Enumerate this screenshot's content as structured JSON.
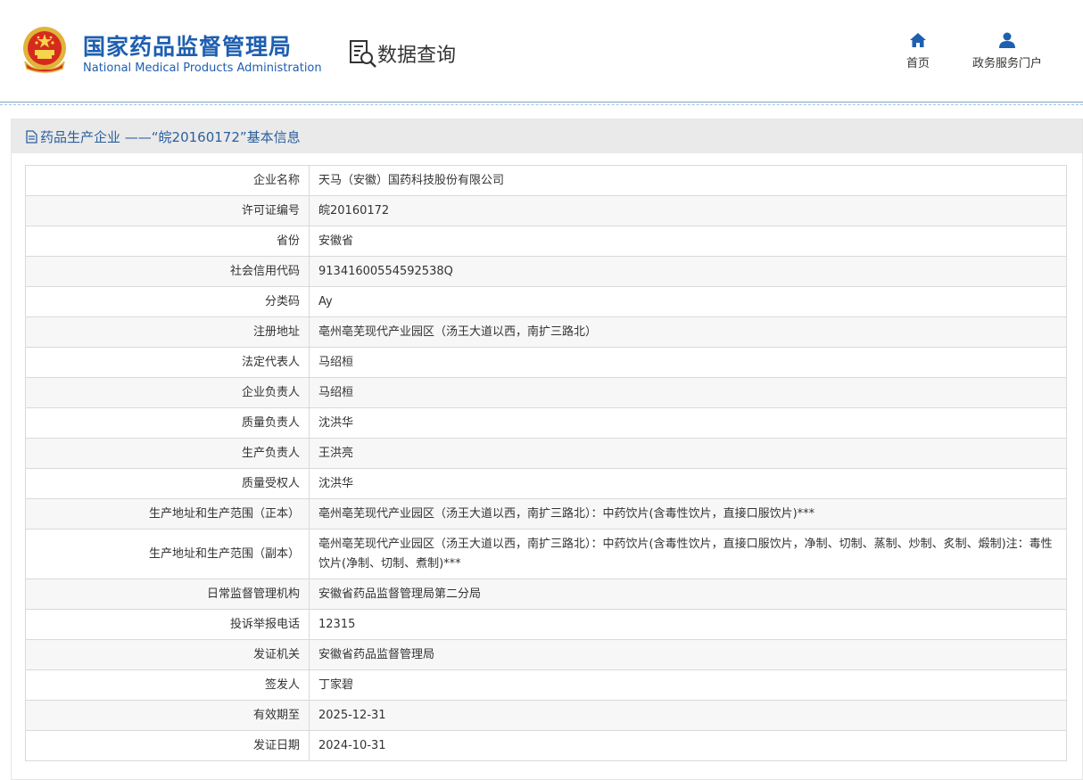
{
  "header": {
    "brand_cn": "国家药品监督管理局",
    "brand_en": "National Medical Products Administration",
    "query_title": "数据查询",
    "nav_home": "首页",
    "nav_portal": "政务服务门户",
    "icons": [
      "national-emblem-icon",
      "data-query-icon",
      "home-icon",
      "user-icon"
    ],
    "accent_color": "#1e5fb0"
  },
  "panel": {
    "title": "药品生产企业 ——“皖20160172”基本信息",
    "icon": "document-icon"
  },
  "rows": [
    {
      "label": "企业名称",
      "value": "天马（安徽）国药科技股份有限公司"
    },
    {
      "label": "许可证编号",
      "value": "皖20160172"
    },
    {
      "label": "省份",
      "value": "安徽省"
    },
    {
      "label": "社会信用代码",
      "value": "91341600554592538Q"
    },
    {
      "label": "分类码",
      "value": "Ay"
    },
    {
      "label": "注册地址",
      "value": "亳州亳芜现代产业园区（汤王大道以西，南扩三路北）"
    },
    {
      "label": "法定代表人",
      "value": "马绍桓"
    },
    {
      "label": "企业负责人",
      "value": "马绍桓"
    },
    {
      "label": "质量负责人",
      "value": "沈洪华"
    },
    {
      "label": "生产负责人",
      "value": "王洪亮"
    },
    {
      "label": "质量受权人",
      "value": "沈洪华"
    },
    {
      "label": "生产地址和生产范围（正本）",
      "value": "亳州亳芜现代产业园区（汤王大道以西，南扩三路北）：中药饮片(含毒性饮片，直接口服饮片)***"
    },
    {
      "label": "生产地址和生产范围（副本）",
      "value": "亳州亳芜现代产业园区（汤王大道以西，南扩三路北）：中药饮片(含毒性饮片，直接口服饮片，净制、切制、蒸制、炒制、炙制、煅制)注：毒性饮片(净制、切制、煮制)***"
    },
    {
      "label": "日常监督管理机构",
      "value": "安徽省药品监督管理局第二分局"
    },
    {
      "label": "投诉举报电话",
      "value": "12315"
    },
    {
      "label": "发证机关",
      "value": "安徽省药品监督管理局"
    },
    {
      "label": "签发人",
      "value": "丁家碧"
    },
    {
      "label": "有效期至",
      "value": "2025-12-31"
    },
    {
      "label": "发证日期",
      "value": "2024-10-31"
    }
  ]
}
